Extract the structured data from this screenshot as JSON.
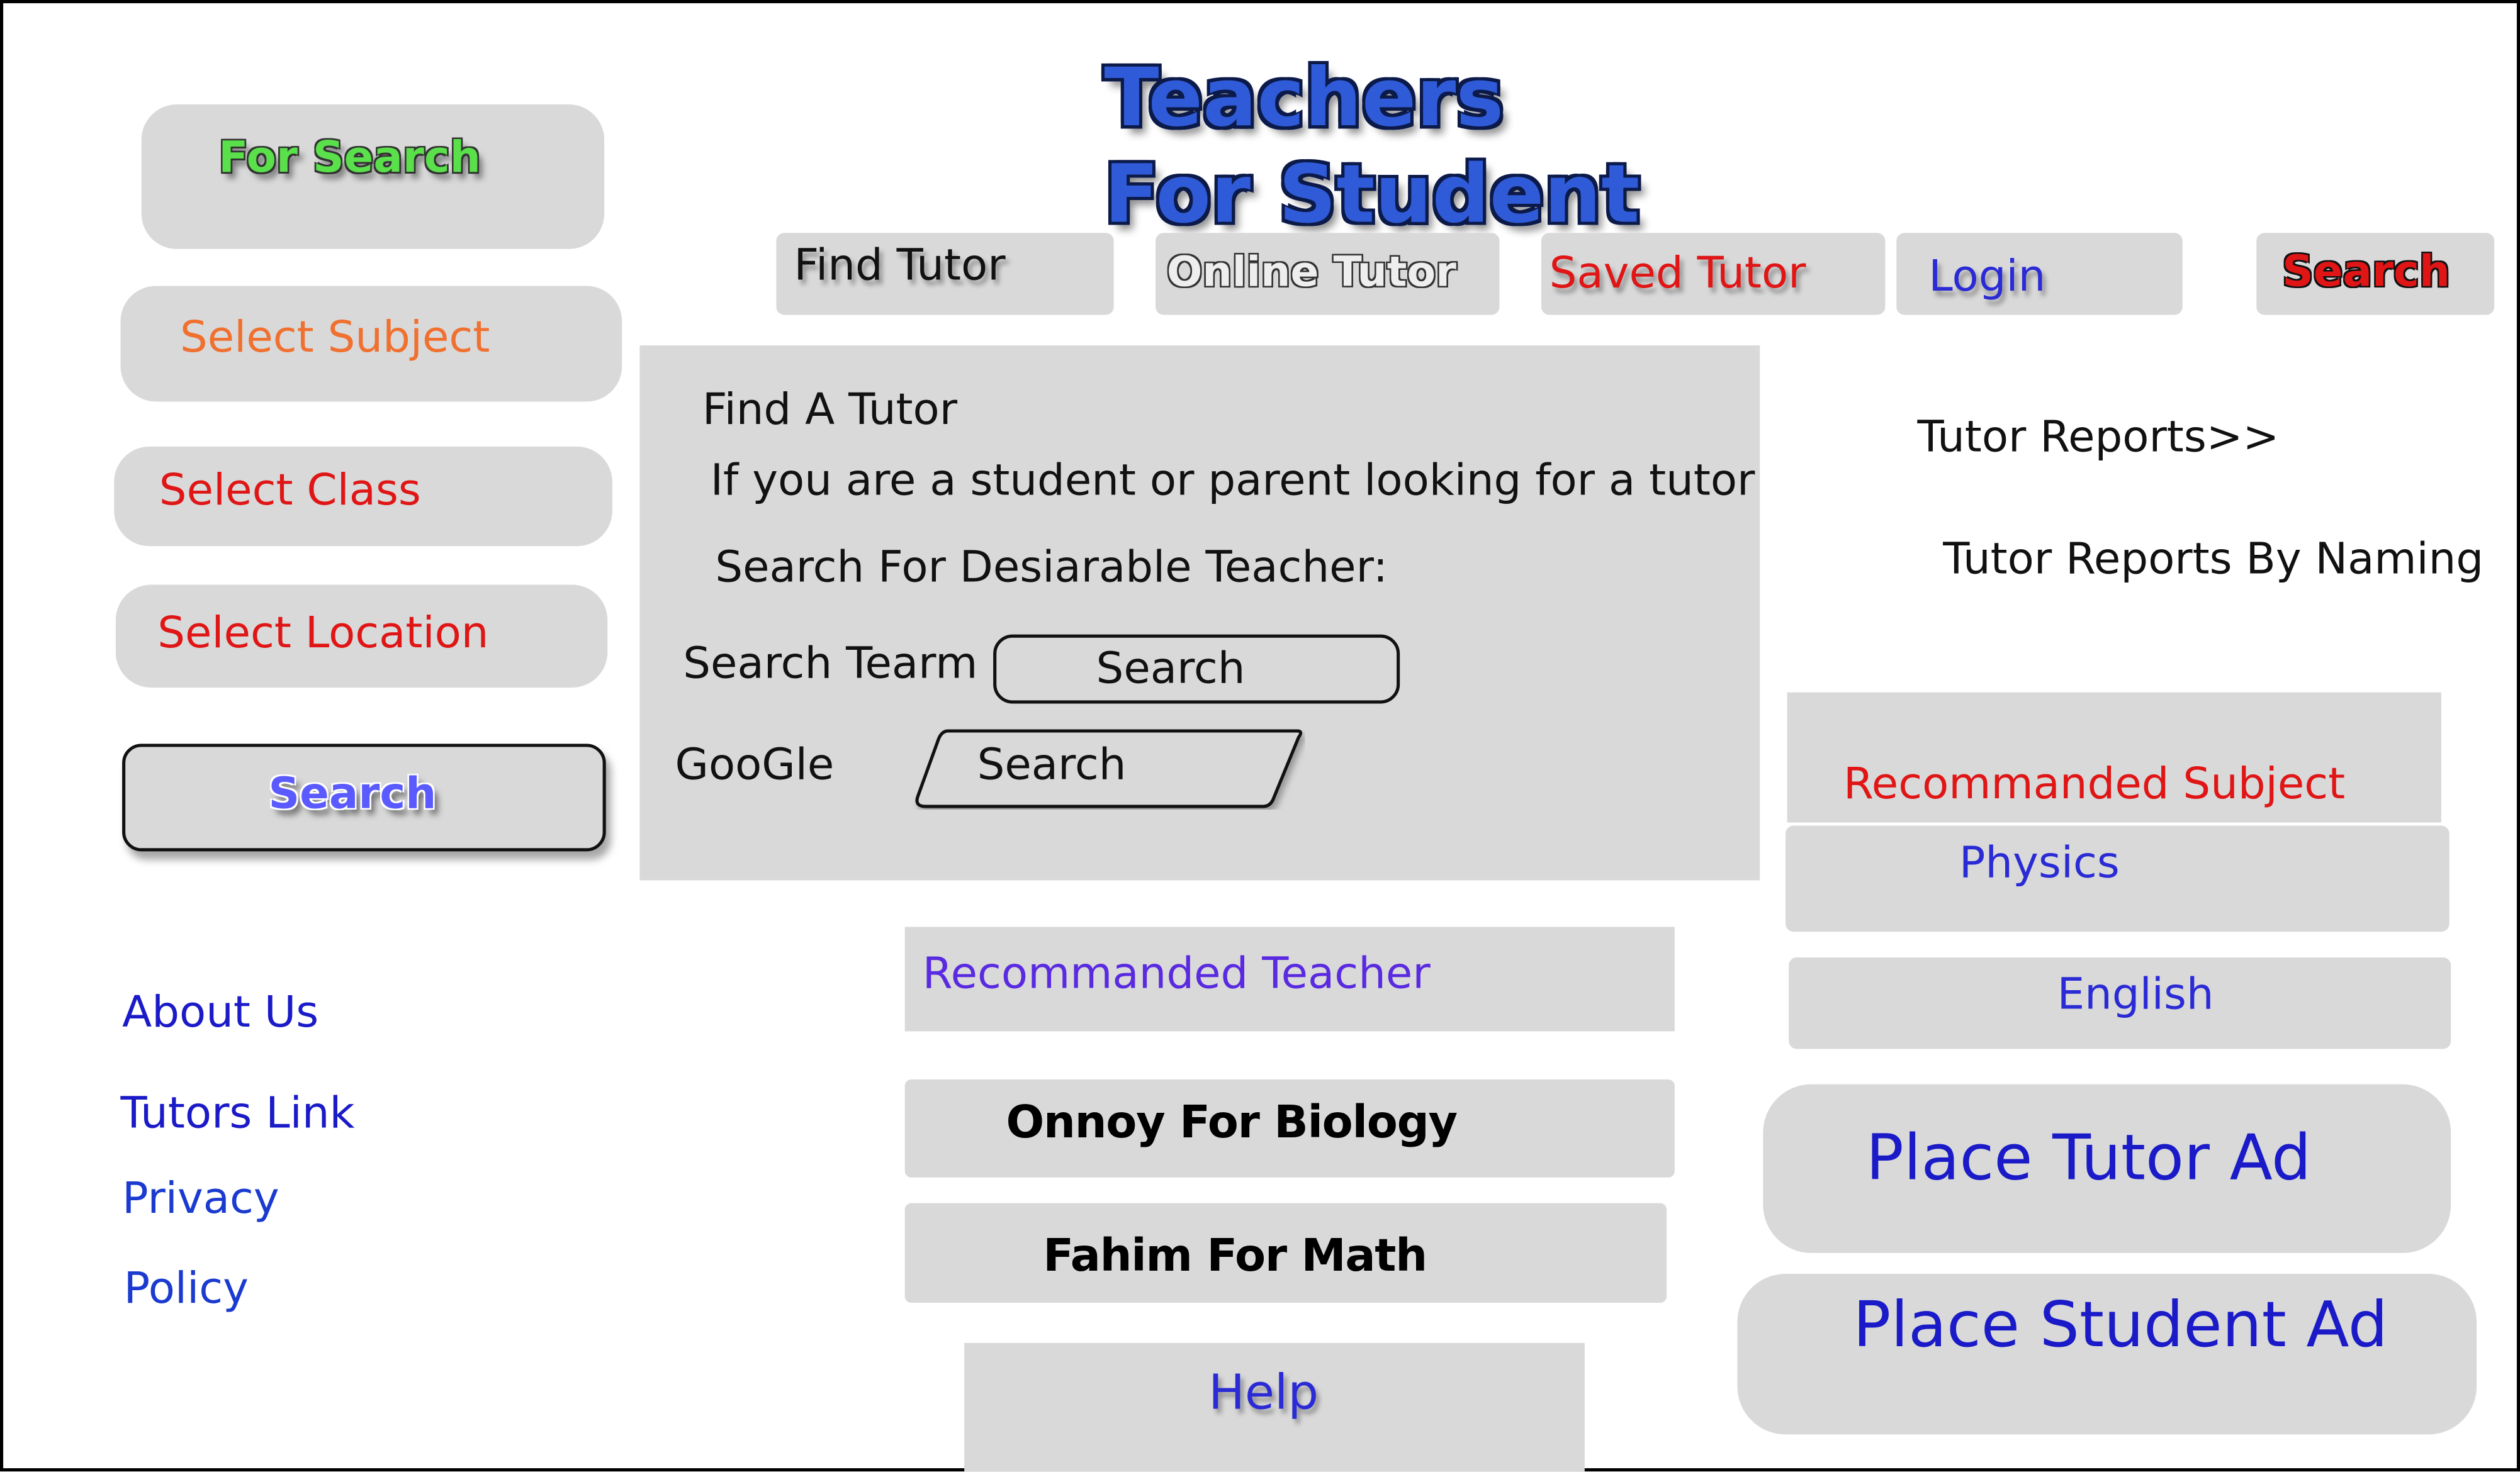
{
  "header": {
    "title_line1": "Teachers",
    "title_line2": "For Student"
  },
  "nav": {
    "find_tutor": "Find Tutor",
    "online_tutor": "Online Tutor",
    "saved_tutor": "Saved Tutor",
    "login": "Login",
    "search": "Search"
  },
  "sidebar": {
    "heading": "For Search",
    "select_subject": "Select Subject",
    "select_class": "Select Class",
    "select_location": "Select Location",
    "search_button": "Search",
    "links": {
      "about": "About Us",
      "tutors_link": "Tutors Link",
      "privacy": "Privacy",
      "policy": "Policy"
    }
  },
  "find_panel": {
    "title": "Find A Tutor",
    "subtitle": "If you are a student or parent looking for a tutor",
    "prompt": "Search For Desiarable Teacher:",
    "search_term_label": "Search Tearm",
    "search_term_button": "Search",
    "google_label": "GooGle",
    "google_button": "Search"
  },
  "recommended_teacher": {
    "heading": "Recommanded Teacher",
    "items": [
      "Onnoy For Biology",
      "Fahim For Math"
    ]
  },
  "help": "Help",
  "right": {
    "tutor_reports": "Tutor Reports>>",
    "tutor_reports_by_naming": "Tutor Reports By Naming",
    "recommended_subject": "Recommanded Subject",
    "subjects": [
      "Physics",
      "English"
    ],
    "place_tutor_ad": "Place Tutor Ad",
    "place_student_ad": "Place Student Ad"
  },
  "colors": {
    "panel_gray": "#d9d9d9",
    "link_blue": "#1a1ac8",
    "accent_red": "#e01515",
    "accent_orange": "#f07030",
    "title_blue": "#2f5bd8"
  }
}
